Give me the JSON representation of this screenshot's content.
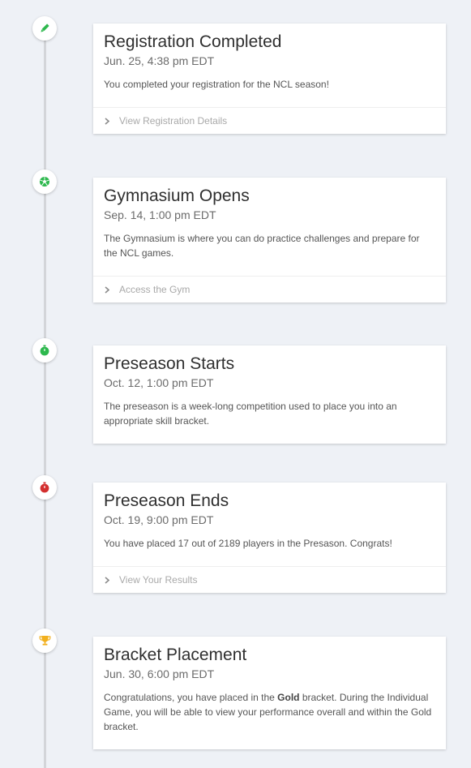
{
  "events": [
    {
      "title": "Registration Completed",
      "date": "Jun. 25, 4:38 pm EDT",
      "description": "You completed your registration for the NCL season!",
      "link": "View Registration Details",
      "icon": "pencil-icon",
      "icon_color": "#2db84d"
    },
    {
      "title": "Gymnasium Opens",
      "date": "Sep. 14, 1:00 pm EDT",
      "description": "The Gymnasium is where you can do practice challenges and prepare for the NCL games.",
      "link": "Access the Gym",
      "icon": "soccer-ball-icon",
      "icon_color": "#2db84d"
    },
    {
      "title": "Preseason Starts",
      "date": "Oct. 12, 1:00 pm EDT",
      "description": "The preseason is a week-long competition used to place you into an appropriate skill bracket.",
      "icon": "stopwatch-icon",
      "icon_color": "#2db84d"
    },
    {
      "title": "Preseason Ends",
      "date": "Oct. 19, 9:00 pm EDT",
      "description": "You have placed 17 out of 2189 players in the Presason. Congrats!",
      "link": "View Your Results",
      "icon": "stopwatch-icon",
      "icon_color": "#d32f2f"
    },
    {
      "title": "Bracket Placement",
      "date": "Jun. 30, 6:00 pm EDT",
      "description_before": "Congratulations, you have placed in the ",
      "description_bold": "Gold",
      "description_after": " bracket. During the Individual Game, you will be able to view your performance overall and within the Gold bracket.",
      "icon": "trophy-icon",
      "icon_color": "#f2b01e"
    }
  ]
}
